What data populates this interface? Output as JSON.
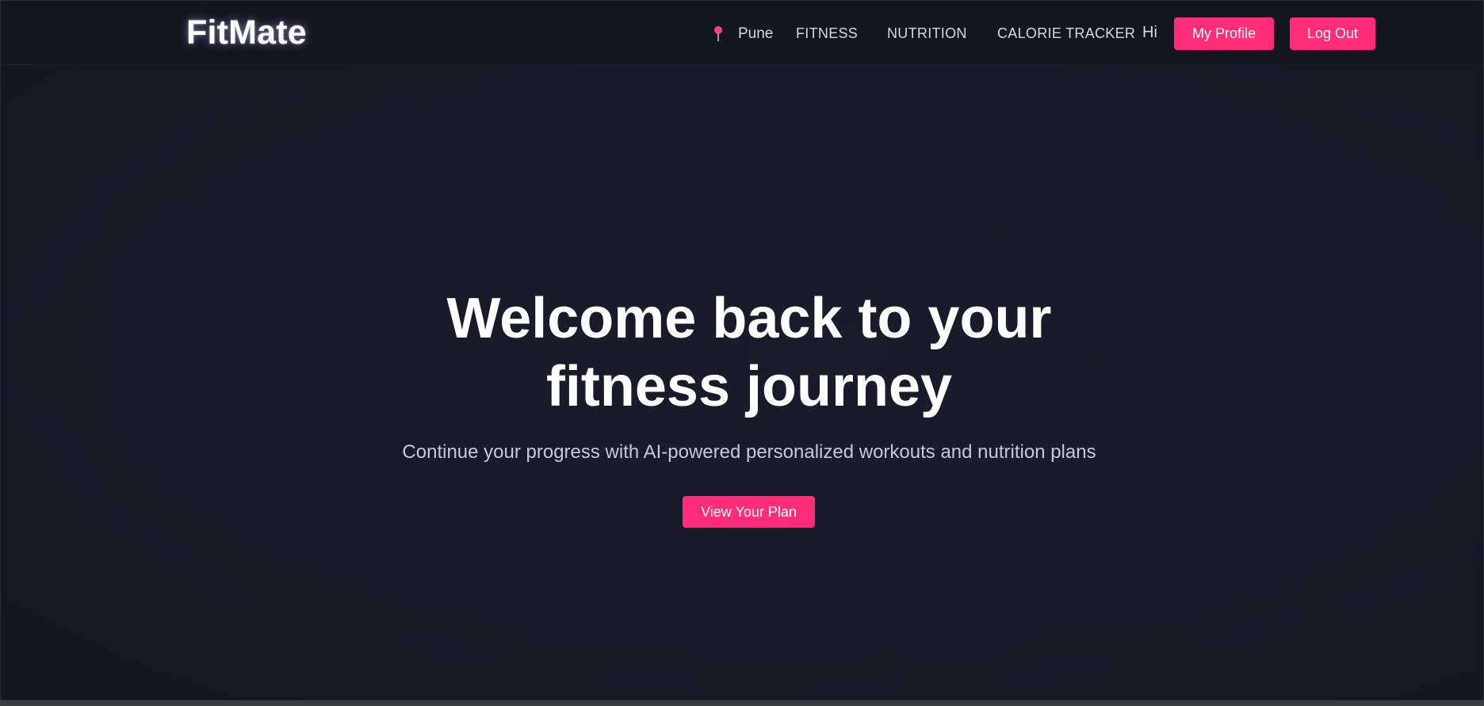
{
  "nav": {
    "brand": "FitMate",
    "location": "Pune",
    "links": [
      "FITNESS",
      "NUTRITION",
      "CALORIE TRACKER"
    ],
    "greeting": "Hi",
    "profile_label": "My Profile",
    "logout_label": "Log Out"
  },
  "hero": {
    "title_line1": "Welcome back to your",
    "title_line2": "fitness journey",
    "subtitle": "Continue your progress with AI-powered personalized workouts and nutrition plans",
    "cta_label": "View Your Plan"
  },
  "colors": {
    "accent": "#ff2d78",
    "background": "#181826",
    "navbar": "#15151f",
    "text": "#ffffff"
  },
  "icons": {
    "location": "map-pin-icon"
  }
}
